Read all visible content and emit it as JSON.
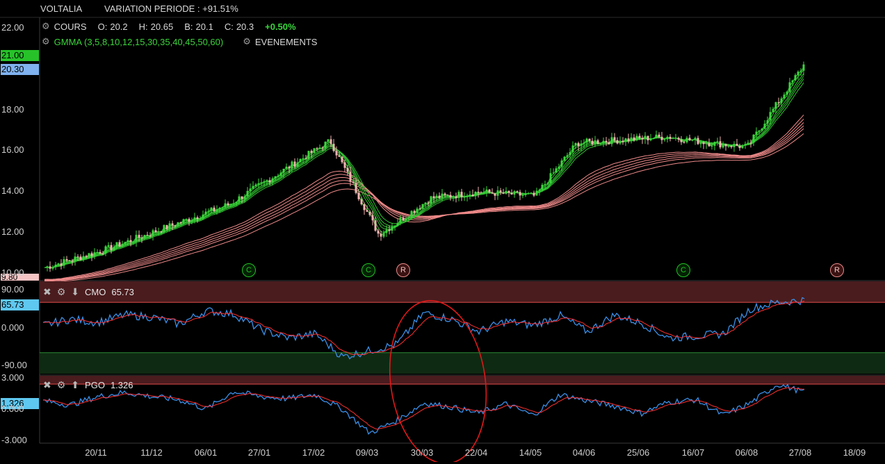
{
  "header": {
    "symbol": "VOLTALIA",
    "variation": "VARIATION PERIODE : +91.51%"
  },
  "cours": {
    "label": "COURS",
    "o_label": "O:",
    "o": "20.2",
    "h_label": "H:",
    "h": "20.65",
    "b_label": "B:",
    "b": "20.1",
    "c_label": "C:",
    "c": "20.3",
    "change": "+0.50%"
  },
  "gmma": {
    "label": "GMMA (3,5,8,10,12,15,30,35,40,45,50,60)",
    "events": "EVENEMENTS"
  },
  "price_tags": {
    "top": "21.00",
    "mid": "20.30",
    "bottom": "9.80"
  },
  "cmo": {
    "name": "CMO",
    "value": "65.73",
    "tag": "65.73"
  },
  "pgo": {
    "name": "PGO",
    "value": "1.326",
    "tag": "1.326"
  },
  "colors": {
    "bull": "#3cd43c",
    "bear": "#f3b2b2",
    "long_ma": "#f08a8a",
    "short_ma": "#30c030",
    "ind_line": "#3a8fe8",
    "signal": "#ff3030",
    "band_high": "#4a1c1e",
    "band_low": "#0f2a12"
  },
  "chart_data": [
    {
      "type": "line",
      "title": "",
      "ylim": [
        9.8,
        22.5
      ],
      "yticks": [
        "22.00",
        "18.00",
        "16.00",
        "14.00",
        "12.00",
        "10.00"
      ],
      "x": [
        "20/11",
        "11/12",
        "06/01",
        "27/01",
        "17/02",
        "09/03",
        "30/03",
        "22/04",
        "14/05",
        "04/06",
        "25/06",
        "16/07",
        "06/08",
        "27/08",
        "18/09"
      ],
      "series": [
        {
          "values": [
            10.3,
            11.2,
            12.9,
            13.4,
            16.5,
            11.9,
            13.7,
            14.0,
            13.8,
            16.4,
            16.7,
            16.4,
            16.2,
            20.3
          ]
        }
      ],
      "events": [
        {
          "x": "27/01",
          "label": "C"
        },
        {
          "x": "09/03",
          "label": "R"
        },
        {
          "x": "30/03",
          "label": "C"
        },
        {
          "x": "16/07",
          "label": "C"
        },
        {
          "x": "18/09",
          "label": "R"
        }
      ]
    },
    {
      "type": "line",
      "title": "CMO",
      "ylim": [
        -110,
        110
      ],
      "yticks": [
        "90.00",
        "0.000",
        "-90.00"
      ],
      "series": [
        {
          "values": [
            5,
            20,
            12,
            30,
            25,
            8,
            40,
            32,
            -5,
            -25,
            -15,
            -70,
            -55,
            -40,
            35,
            20,
            -10,
            15,
            5,
            28,
            -10,
            30,
            10,
            -25,
            -20,
            -15,
            45,
            60,
            65
          ]
        }
      ]
    },
    {
      "type": "line",
      "title": "PGO",
      "ylim": [
        -3.2,
        3.2
      ],
      "yticks": [
        "3.000",
        "0.000",
        "-3.000"
      ],
      "series": [
        {
          "values": [
            0.8,
            0.4,
            1.2,
            1.6,
            1.2,
            0.9,
            0.0,
            1.7,
            1.2,
            1.0,
            1.4,
            0.0,
            -2.3,
            -1.1,
            0.6,
            0.2,
            -0.4,
            0.5,
            -0.6,
            1.4,
            0.8,
            0.3,
            -0.4,
            0.7,
            0.9,
            -0.6,
            0.6,
            2.4,
            1.6
          ]
        }
      ]
    }
  ]
}
